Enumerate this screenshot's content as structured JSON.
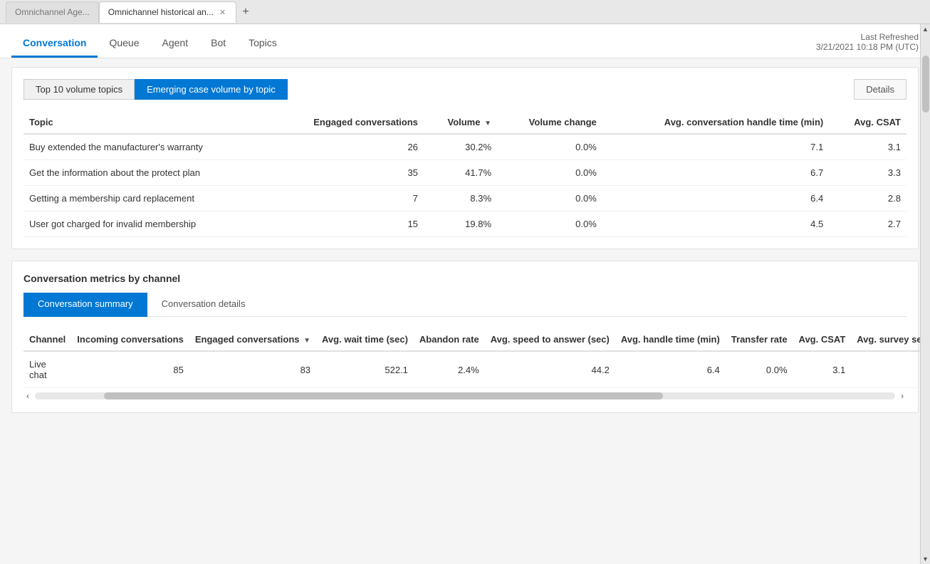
{
  "browser": {
    "tabs": [
      {
        "id": "tab1",
        "label": "Omnichannel Age...",
        "active": false
      },
      {
        "id": "tab2",
        "label": "Omnichannel historical an...",
        "active": true
      },
      {
        "id": "add",
        "label": "+",
        "active": false
      }
    ]
  },
  "header": {
    "nav_tabs": [
      {
        "id": "conversation",
        "label": "Conversation",
        "active": true
      },
      {
        "id": "queue",
        "label": "Queue",
        "active": false
      },
      {
        "id": "agent",
        "label": "Agent",
        "active": false
      },
      {
        "id": "bot",
        "label": "Bot",
        "active": false
      },
      {
        "id": "topics",
        "label": "Topics",
        "active": false
      }
    ],
    "last_refreshed_label": "Last Refreshed",
    "last_refreshed_value": "3/21/2021 10:18 PM (UTC)"
  },
  "topics_section": {
    "tabs": [
      {
        "id": "top10",
        "label": "Top 10 volume topics",
        "active": false
      },
      {
        "id": "emerging",
        "label": "Emerging case volume by topic",
        "active": true
      }
    ],
    "details_button": "Details",
    "table": {
      "columns": [
        {
          "id": "topic",
          "label": "Topic",
          "align": "left"
        },
        {
          "id": "engaged",
          "label": "Engaged conversations",
          "align": "right"
        },
        {
          "id": "volume",
          "label": "Volume",
          "align": "right",
          "sort": true
        },
        {
          "id": "volume_change",
          "label": "Volume change",
          "align": "right"
        },
        {
          "id": "avg_handle",
          "label": "Avg. conversation handle time (min)",
          "align": "right"
        },
        {
          "id": "avg_csat",
          "label": "Avg. CSAT",
          "align": "right"
        }
      ],
      "rows": [
        {
          "topic": "Buy extended the manufacturer's warranty",
          "engaged": "26",
          "volume": "30.2%",
          "volume_change": "0.0%",
          "avg_handle": "7.1",
          "avg_csat": "3.1"
        },
        {
          "topic": "Get the information about the protect plan",
          "engaged": "35",
          "volume": "41.7%",
          "volume_change": "0.0%",
          "avg_handle": "6.7",
          "avg_csat": "3.3"
        },
        {
          "topic": "Getting a membership card replacement",
          "engaged": "7",
          "volume": "8.3%",
          "volume_change": "0.0%",
          "avg_handle": "6.4",
          "avg_csat": "2.8"
        },
        {
          "topic": "User got charged for invalid membership",
          "engaged": "15",
          "volume": "19.8%",
          "volume_change": "0.0%",
          "avg_handle": "4.5",
          "avg_csat": "2.7"
        }
      ]
    }
  },
  "metrics_section": {
    "title": "Conversation metrics by channel",
    "sub_tabs": [
      {
        "id": "summary",
        "label": "Conversation summary",
        "active": true
      },
      {
        "id": "details",
        "label": "Conversation details",
        "active": false
      }
    ],
    "table": {
      "columns": [
        {
          "id": "channel",
          "label": "Channel",
          "align": "left"
        },
        {
          "id": "incoming",
          "label": "Incoming conversations",
          "align": "right"
        },
        {
          "id": "engaged",
          "label": "Engaged conversations",
          "align": "right",
          "sort": true
        },
        {
          "id": "avg_wait",
          "label": "Avg. wait time (sec)",
          "align": "right"
        },
        {
          "id": "abandon_rate",
          "label": "Abandon rate",
          "align": "right"
        },
        {
          "id": "avg_speed",
          "label": "Avg. speed to answer (sec)",
          "align": "right"
        },
        {
          "id": "avg_handle",
          "label": "Avg. handle time (min)",
          "align": "right"
        },
        {
          "id": "transfer_rate",
          "label": "Transfer rate",
          "align": "right"
        },
        {
          "id": "avg_csat",
          "label": "Avg. CSAT",
          "align": "right"
        },
        {
          "id": "avg_survey",
          "label": "Avg. survey se",
          "align": "right"
        }
      ],
      "rows": [
        {
          "channel": "Live chat",
          "incoming": "85",
          "engaged": "83",
          "avg_wait": "522.1",
          "abandon_rate": "2.4%",
          "avg_speed": "44.2",
          "avg_handle": "6.4",
          "transfer_rate": "0.0%",
          "avg_csat": "3.1",
          "avg_survey": ""
        }
      ]
    }
  },
  "colors": {
    "primary": "#0078d4",
    "active_tab_border": "#0078d4",
    "header_bg": "#ffffff",
    "card_bg": "#ffffff",
    "table_header_border": "#e0e0e0"
  }
}
